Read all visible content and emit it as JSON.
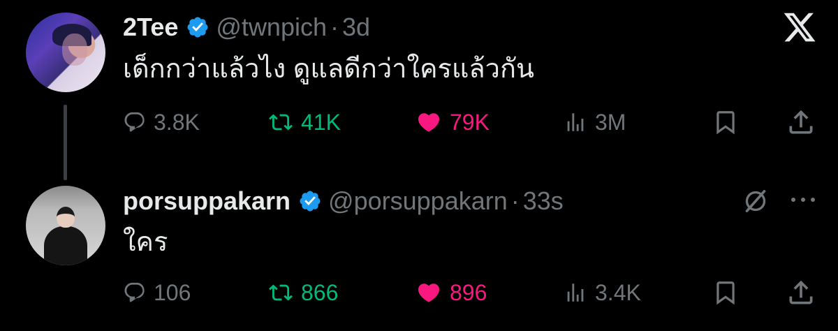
{
  "colors": {
    "background": "#000000",
    "text": "#e7e9ea",
    "muted": "#71767b",
    "retweet_active": "#00ba7c",
    "like_active": "#f91880",
    "verified": "#1d9bf0"
  },
  "tweets": [
    {
      "name": "2Tee",
      "handle": "@twnpich",
      "separator": "·",
      "time": "3d",
      "text": "เด็กกว่าแล้วไง ดูแลดีกว่าใครแล้วกัน",
      "stats": {
        "replies": "3.8K",
        "retweets": "41K",
        "likes": "79K",
        "views": "3M"
      }
    },
    {
      "name": "porsuppakarn",
      "handle": "@porsuppakarn",
      "separator": "·",
      "time": "33s",
      "text": "ใคร",
      "stats": {
        "replies": "106",
        "retweets": "866",
        "likes": "896",
        "views": "3.4K"
      }
    }
  ],
  "icons": [
    "x-logo-icon",
    "verified-badge-icon",
    "reply-icon",
    "retweet-icon",
    "like-heart-icon",
    "views-chart-icon",
    "bookmark-icon",
    "share-icon",
    "grok-icon",
    "more-icon"
  ]
}
